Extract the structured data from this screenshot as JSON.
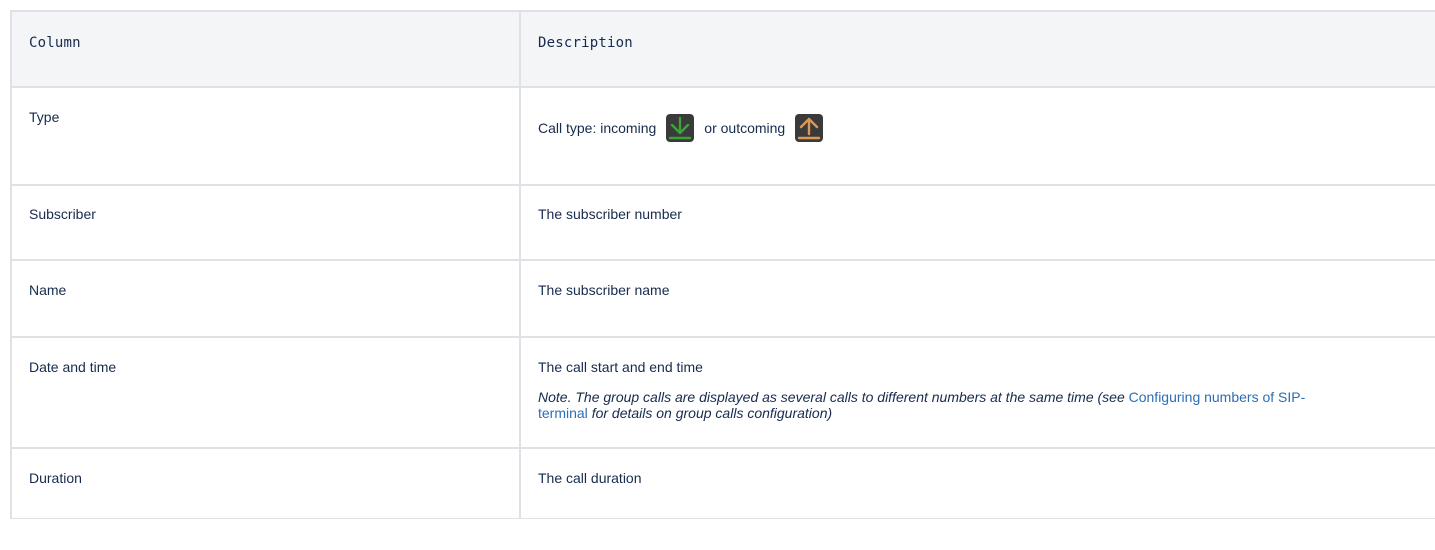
{
  "table": {
    "headers": {
      "column": "Column",
      "description": "Description"
    },
    "rows": [
      {
        "column": "Type",
        "description_prefix": "Call type: incoming",
        "description_mid": "or outcoming",
        "icons": [
          "incoming-call-icon",
          "outgoing-call-icon"
        ]
      },
      {
        "column": "Subscriber",
        "description": "The subscriber number"
      },
      {
        "column": "Name",
        "description": "The subscriber name"
      },
      {
        "column": "Date and time",
        "description": "The call start and end time",
        "note_before": "Note. The group calls are displayed as several calls to different numbers at the same time (see",
        "note_link": "Configuring numbers of SIP-terminal",
        "note_after": "for details on group calls configuration)"
      },
      {
        "column": "Duration",
        "description": "The call duration"
      }
    ]
  },
  "colors": {
    "header_bg": "#f4f5f7",
    "border": "#dfe1e6",
    "incoming_icon": "#3aa43a",
    "outgoing_icon": "#d9985a",
    "link": "#2d6eb5"
  }
}
